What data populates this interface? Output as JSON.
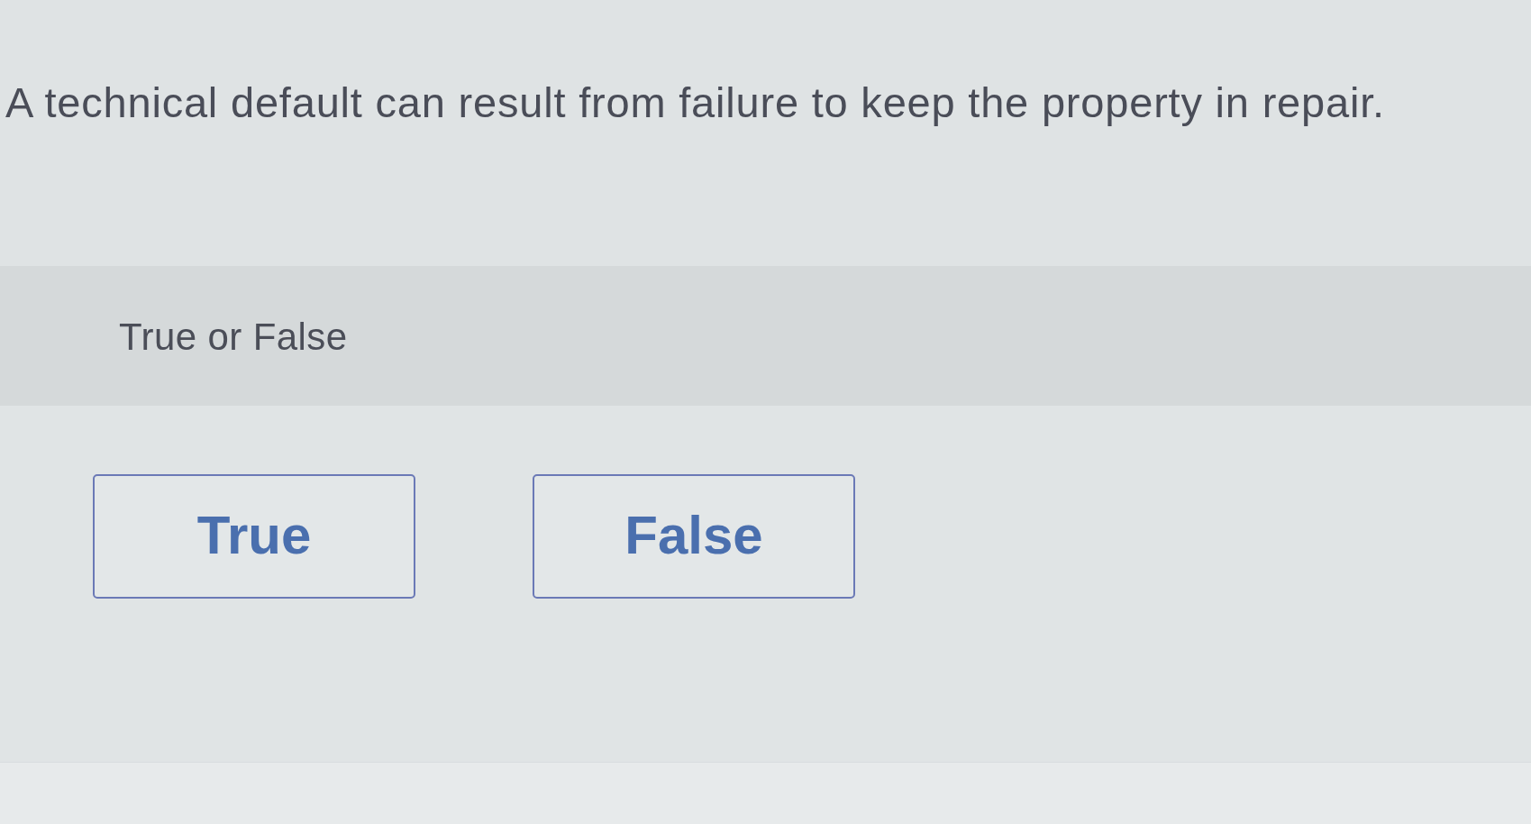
{
  "question": {
    "text": "A technical default can result from failure to keep the property in repair."
  },
  "prompt": {
    "text": "True or False"
  },
  "options": [
    {
      "label": "True",
      "selected": false
    },
    {
      "label": "False",
      "selected": false
    }
  ]
}
